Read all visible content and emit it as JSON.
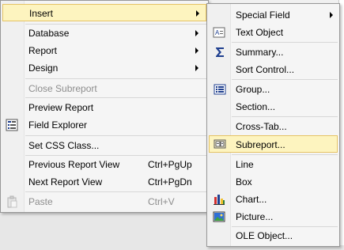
{
  "context_menu": {
    "items": [
      {
        "label": "Insert"
      },
      {
        "label": "Database"
      },
      {
        "label": "Report"
      },
      {
        "label": "Design"
      },
      {
        "label": "Close Subreport"
      },
      {
        "label": "Preview Report"
      },
      {
        "label": "Field Explorer"
      },
      {
        "label": "Set CSS Class..."
      },
      {
        "label": "Previous Report View",
        "shortcut": "Ctrl+PgUp"
      },
      {
        "label": "Next Report View",
        "shortcut": "Ctrl+PgDn"
      },
      {
        "label": "Paste",
        "shortcut": "Ctrl+V"
      }
    ]
  },
  "insert_submenu": {
    "items": [
      {
        "label": "Special Field"
      },
      {
        "label": "Text Object"
      },
      {
        "label": "Summary..."
      },
      {
        "label": "Sort Control..."
      },
      {
        "label": "Group..."
      },
      {
        "label": "Section..."
      },
      {
        "label": "Cross-Tab..."
      },
      {
        "label": "Subreport..."
      },
      {
        "label": "Line"
      },
      {
        "label": "Box"
      },
      {
        "label": "Chart..."
      },
      {
        "label": "Picture..."
      },
      {
        "label": "OLE Object..."
      }
    ]
  },
  "colors": {
    "highlight_fill": "#fdf4bf",
    "highlight_border": "#e5c365",
    "menu_background": "#f5f5f5",
    "disabled_text": "#8d8d8d"
  },
  "icons": {
    "field_explorer": "field-explorer-icon",
    "paste": "paste-icon",
    "text_object": "text-object-icon",
    "summary": "sigma-icon",
    "group": "group-icon",
    "subreport": "subreport-icon",
    "chart": "bar-chart-icon",
    "picture": "picture-icon"
  }
}
